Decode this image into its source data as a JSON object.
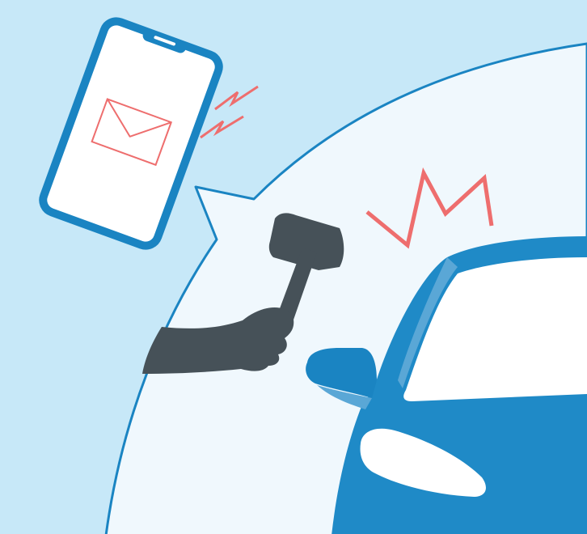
{
  "colors": {
    "background": "#c7e8f8",
    "bubble_fill": "#f0f8fd",
    "bubble_stroke": "#1a84c2",
    "phone_frame": "#1a84c2",
    "car_body": "#1f8ac7",
    "car_highlight": "#5aa7d6",
    "car_mirror": "#1a84c2",
    "windshield": "#ffffff",
    "arm_hammer": "#465158",
    "alert_marks": "#ee6e6e",
    "envelope": "#ee6e6e"
  },
  "icons": {
    "phone": "smartphone-icon",
    "mail": "envelope-icon",
    "vibration": "vibration-zigzag-icon",
    "impact": "impact-burst-icon",
    "hammer": "hammer-icon",
    "car": "car-icon"
  }
}
